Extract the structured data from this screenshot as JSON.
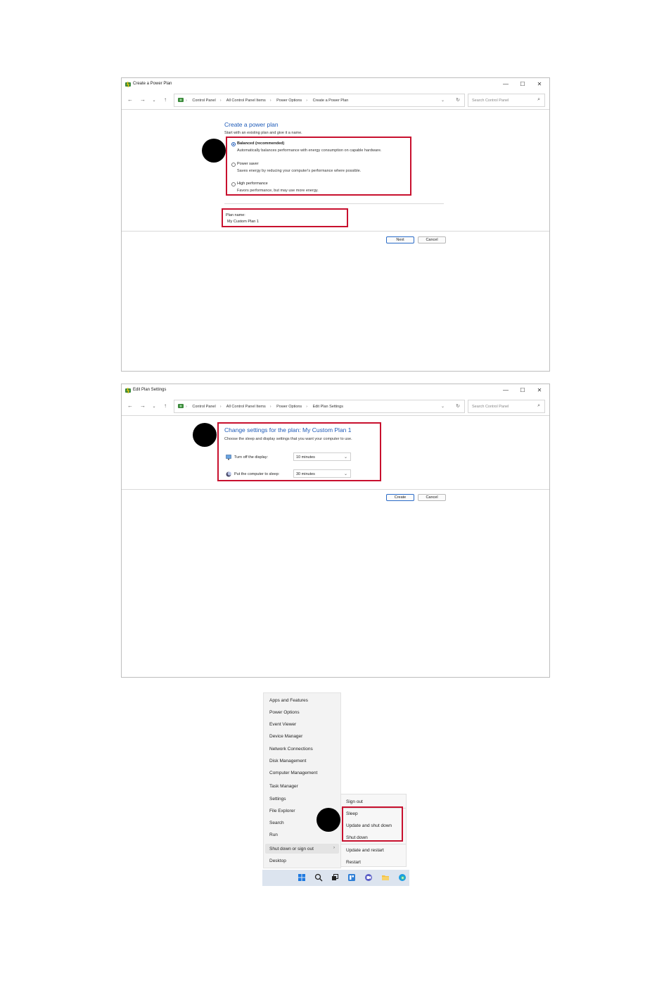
{
  "window1": {
    "title": "Create a Power Plan",
    "breadcrumb": [
      "Control Panel",
      "All Control Panel Items",
      "Power Options",
      "Create a Power Plan"
    ],
    "search_placeholder": "Search Control Panel",
    "heading": "Create a power plan",
    "subtext": "Start with an existing plan and give it a name.",
    "plans": [
      {
        "label": "Balanced (recommended)",
        "desc": "Automatically balances performance with energy consumption on capable hardware.",
        "selected": true
      },
      {
        "label": "Power saver",
        "desc": "Saves energy by reducing your computer's performance where possible.",
        "selected": false
      },
      {
        "label": "High performance",
        "desc": "Favors performance, but may use more energy.",
        "selected": false
      }
    ],
    "plan_name_label": "Plan name:",
    "plan_name_value": "My Custom Plan 1",
    "next_label": "Next",
    "cancel_label": "Cancel"
  },
  "window2": {
    "title": "Edit Plan Settings",
    "breadcrumb": [
      "Control Panel",
      "All Control Panel Items",
      "Power Options",
      "Edit Plan Settings"
    ],
    "search_placeholder": "Search Control Panel",
    "heading": "Change settings for the plan: My Custom Plan 1",
    "subtext": "Choose the sleep and display settings that you want your computer to use.",
    "display_label": "Turn off the display:",
    "display_value": "10 minutes",
    "sleep_label": "Put the computer to sleep:",
    "sleep_value": "30 minutes",
    "create_label": "Create",
    "cancel_label": "Cancel"
  },
  "winx_menu": {
    "items": [
      "Apps and Features",
      "Power Options",
      "Event Viewer",
      "Device Manager",
      "Network Connections",
      "Disk Management",
      "Computer Management",
      "Task Manager",
      "Settings",
      "File Explorer",
      "Search",
      "Run",
      "Shut down or sign out",
      "Desktop"
    ]
  },
  "shutdown_submenu": {
    "items": [
      "Sign out",
      "Sleep",
      "Update and shut down",
      "Shut down",
      "Update and restart",
      "Restart"
    ]
  },
  "colors": {
    "accent": "#1e5bb8",
    "highlight_box": "#c8102e"
  }
}
